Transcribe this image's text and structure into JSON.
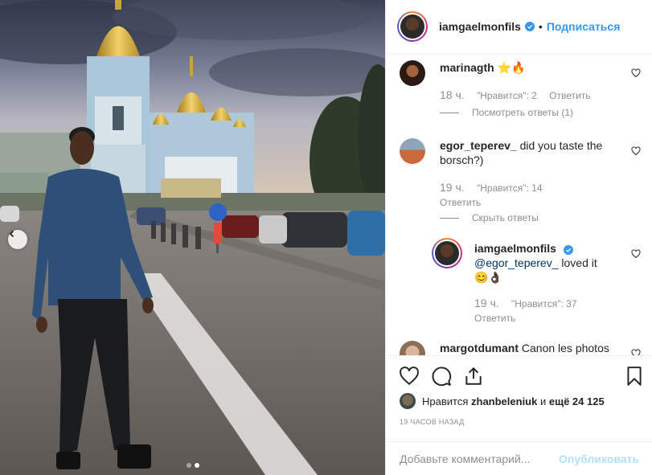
{
  "post": {
    "photo_alt": "",
    "carousel": {
      "total": 2,
      "active": 2
    }
  },
  "header": {
    "username": "iamgaelmonfils",
    "separator": "•",
    "follow_label": "Подписаться",
    "more_label": "···"
  },
  "comments": [
    {
      "username": "marinagth",
      "text": "⭐🔥",
      "time": "18 ч.",
      "likes": "\"Нравится\": 2",
      "reply": "Ответить",
      "replies_toggle": "Посмотреть ответы (1)"
    },
    {
      "username": "egor_teperev_",
      "text": "did you taste the borsch?)",
      "time": "19 ч.",
      "likes": "\"Нравится\": 14",
      "reply": "Ответить",
      "replies_toggle": "Скрыть ответы"
    },
    {
      "username": "iamgaelmonfils",
      "mention": "@egor_teperev_",
      "text": "loved it",
      "emoji": "😊👌🏿",
      "time": "19 ч.",
      "likes": "\"Нравится\": 37",
      "reply": "Ответить"
    },
    {
      "username": "margotdumant",
      "text": "Canon les photos"
    }
  ],
  "likes_line": {
    "prefix": "Нравится",
    "user": "zhanbeleniuk",
    "middle": "и",
    "rest": "ещё 24 125"
  },
  "posted_ago": "19 ЧАСОВ НАЗАД",
  "add_comment": {
    "placeholder": "Добавьте комментарий...",
    "publish_label": "Опубликовать"
  },
  "colors": {
    "accent": "#3897f0",
    "text": "#262626",
    "muted": "#8e8e8e",
    "publish_disabled": "#b2dffc"
  }
}
